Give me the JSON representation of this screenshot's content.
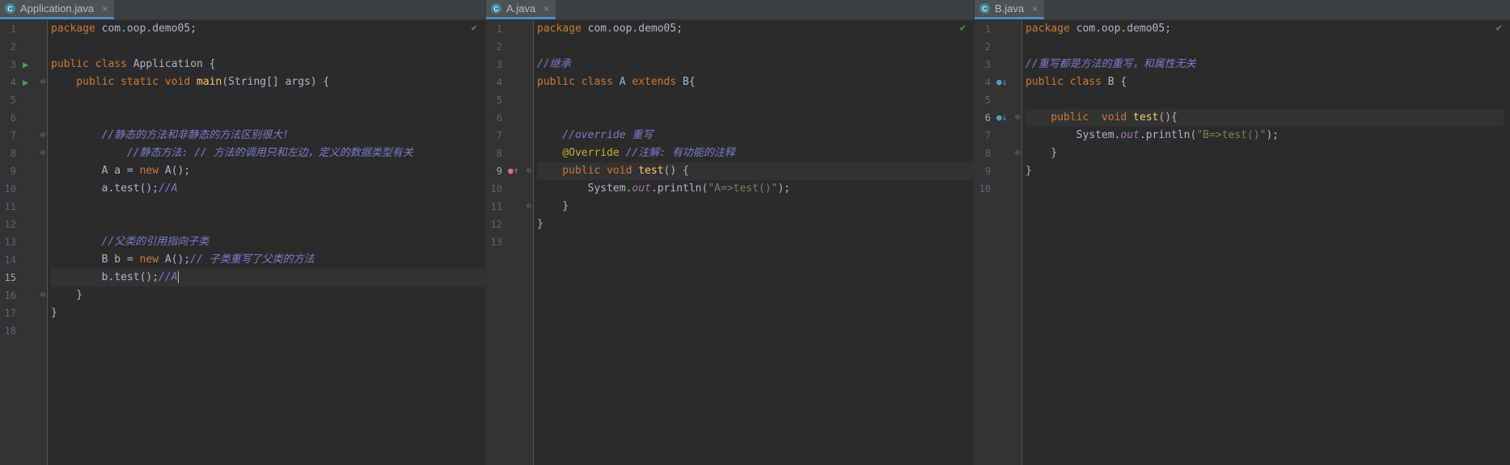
{
  "tabs": {
    "application": {
      "label": "Application.java",
      "icon": "class-icon",
      "letter": "C"
    },
    "a": {
      "label": "A.java",
      "icon": "class-icon",
      "letter": "C"
    },
    "b": {
      "label": "B.java",
      "icon": "class-icon",
      "letter": "C"
    }
  },
  "application": {
    "line_numbers": [
      "1",
      "2",
      "3",
      "4",
      "5",
      "6",
      "7",
      "8",
      "9",
      "10",
      "11",
      "12",
      "13",
      "14",
      "15",
      "16",
      "17",
      "18"
    ],
    "code": {
      "l1_kw": "package",
      "l1_rest": " com.oop.demo05;",
      "l3_kw": "public class",
      "l3_rest": " Application {",
      "l4_kw": "    public static void",
      "l4_fn": " main",
      "l4_rest": "(String[] args) {",
      "l7_cm": "        //静态的方法和非静态的方法区别很大!",
      "l8_cm": "            //静态方法: // 方法的调用只和左边，定义的数据类型有关",
      "l9_pre": "        A a = ",
      "l9_kw": "new",
      "l9_post": " A();",
      "l10_pre": "        a.test();",
      "l10_cm": "//A",
      "l13_cm": "        //父类的引用指向子类",
      "l14_pre": "        B b = ",
      "l14_kw": "new",
      "l14_post": " A();",
      "l14_cm": "// 子类重写了父类的方法",
      "l15_pre": "        b.test();",
      "l15_cm": "//A",
      "l16": "    }",
      "l17": "}"
    }
  },
  "a_file": {
    "line_numbers": [
      "1",
      "2",
      "3",
      "4",
      "5",
      "6",
      "7",
      "8",
      "9",
      "10",
      "11",
      "12",
      "13"
    ],
    "code": {
      "l1_kw": "package",
      "l1_rest": " com.oop.demo05;",
      "l3_cm": "//继承",
      "l4_kw": "public class",
      "l4_mid": " A ",
      "l4_kw2": "extends",
      "l4_rest": " B{",
      "l7_cm": "    //override 重写",
      "l8_ann": "    @Override",
      "l8_cm": " //注解: 有功能的注释",
      "l9_kw": "    public void",
      "l9_fn": " test",
      "l9_rest": "() {",
      "l10_pre": "        System.",
      "l10_fld": "out",
      "l10_mid": ".println(",
      "l10_str": "\"A=>test()\"",
      "l10_post": ");",
      "l11": "    }",
      "l12": "}"
    }
  },
  "b_file": {
    "line_numbers": [
      "1",
      "2",
      "3",
      "4",
      "5",
      "6",
      "7",
      "8",
      "9",
      "10"
    ],
    "code": {
      "l1_kw": "package",
      "l1_rest": " com.oop.demo05;",
      "l3_cm": "//重写都是方法的重写，和属性无关",
      "l4_kw": "public class",
      "l4_rest": " B {",
      "l6_kw": "    public  void",
      "l6_fn": " test",
      "l6_rest": "(){",
      "l7_pre": "        System.",
      "l7_fld": "out",
      "l7_mid": ".println(",
      "l7_str": "\"B=>test()\"",
      "l7_post": ");",
      "l8": "    }",
      "l9": "}"
    }
  },
  "icons": {
    "check": "✔",
    "run": "▶",
    "fold": "⊖",
    "override_up": "●↑",
    "overridden_down": "●↓",
    "close": "×"
  },
  "colors": {
    "keyword": "#cc7832",
    "method": "#ffc66d",
    "comment": "#7a7acf",
    "string": "#6a8759",
    "annotation": "#bbb529",
    "field": "#9876aa",
    "background": "#2b2b2b"
  }
}
